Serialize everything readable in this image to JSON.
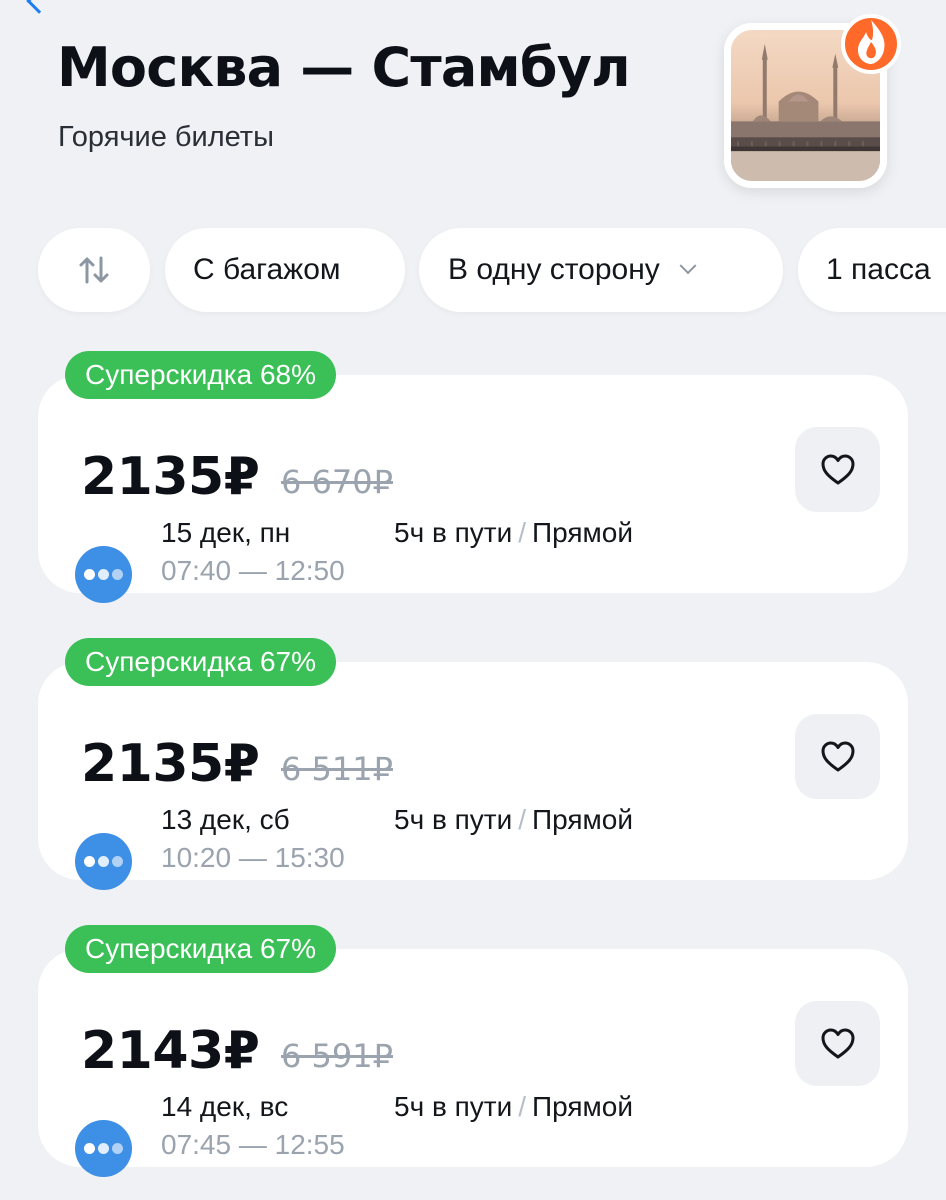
{
  "header": {
    "title": "Москва — Стамбул",
    "subtitle": "Горячие билеты"
  },
  "filters": {
    "swap_icon": "swap-vertical-arrows-icon",
    "baggage_label": "С багажом",
    "direction_label": "В одну сторону",
    "passengers_label": "1 пасса"
  },
  "tickets": [
    {
      "discount": "Суперскидка 68%",
      "price": "2135₽",
      "old_price": "6 670₽",
      "date": "15 дек, пн",
      "time_range": "07:40 — 12:50",
      "duration": "5ч в пути",
      "separator": "/",
      "route_type": "Прямой"
    },
    {
      "discount": "Суперскидка 67%",
      "price": "2135₽",
      "old_price": "6 511₽",
      "date": "13 дек, сб",
      "time_range": "10:20 — 15:30",
      "duration": "5ч в пути",
      "separator": "/",
      "route_type": "Прямой"
    },
    {
      "discount": "Суперскидка 67%",
      "price": "2143₽",
      "old_price": "6 591₽",
      "date": "14 дек, вс",
      "time_range": "07:45 — 12:55",
      "duration": "5ч в пути",
      "separator": "/",
      "route_type": "Прямой"
    }
  ],
  "colors": {
    "discount_badge": "#3bbf57",
    "airline_logo": "#3e8fe6",
    "accent": "#1e7df0"
  }
}
